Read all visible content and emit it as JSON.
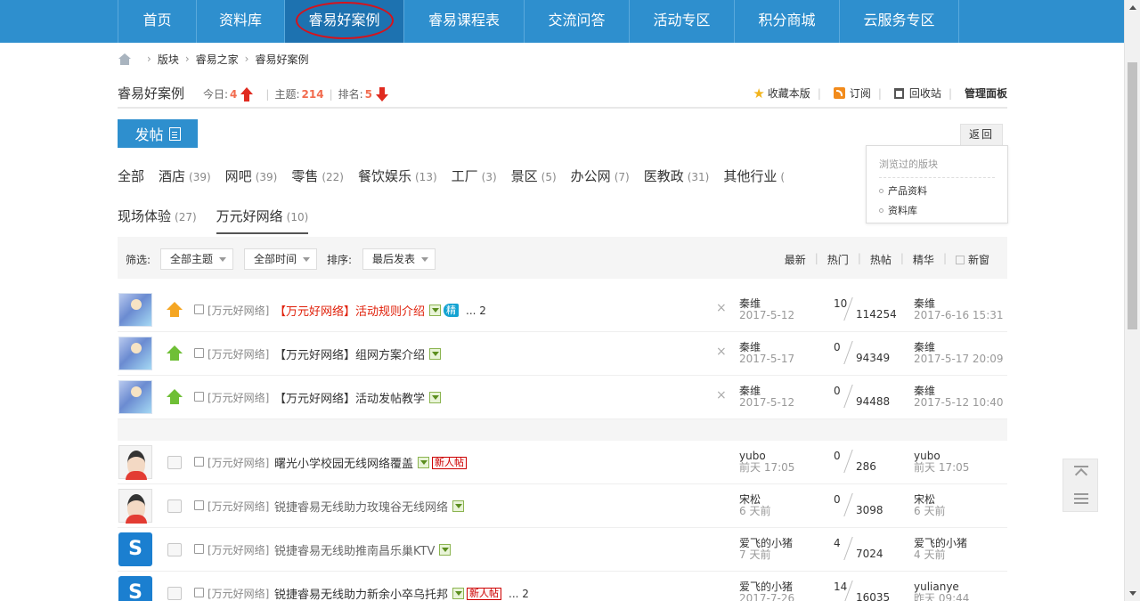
{
  "nav": {
    "items": [
      "首页",
      "资料库",
      "睿易好案例",
      "睿易课程表",
      "交流问答",
      "活动专区",
      "积分商城",
      "云服务专区"
    ],
    "active_index": 2
  },
  "breadcrumb": [
    "版块",
    "睿易之家",
    "睿易好案例"
  ],
  "forum": {
    "name": "睿易好案例",
    "today_label": "今日:",
    "today_value": "4",
    "topics_label": "主题:",
    "topics_value": "214",
    "rank_label": "排名:",
    "rank_value": "5",
    "actions": {
      "favorite": "收藏本版",
      "subscribe": "订阅",
      "recycle": "回收站",
      "admin": "管理面板"
    }
  },
  "post_button": "发帖",
  "back_button": "返回",
  "visited": {
    "title": "浏览过的版块",
    "items": [
      "产品资料",
      "资料库"
    ]
  },
  "categories": [
    {
      "label": "全部",
      "count": ""
    },
    {
      "label": "酒店",
      "count": "(39)"
    },
    {
      "label": "网吧",
      "count": "(39)"
    },
    {
      "label": "零售",
      "count": "(22)"
    },
    {
      "label": "餐饮娱乐",
      "count": "(13)"
    },
    {
      "label": "工厂",
      "count": "(3)"
    },
    {
      "label": "景区",
      "count": "(5)"
    },
    {
      "label": "办公网",
      "count": "(7)"
    },
    {
      "label": "医教政",
      "count": "(31)"
    },
    {
      "label": "其他行业",
      "count": "("
    },
    {
      "label": "现场体验",
      "count": "(27)"
    },
    {
      "label": "万元好网络",
      "count": "(10)"
    }
  ],
  "filter": {
    "filter_label": "筛选:",
    "topic_select": "全部主题",
    "time_select": "全部时间",
    "sort_label": "排序:",
    "sort_select": "最后发表",
    "tabs": [
      "最新",
      "热门",
      "热帖",
      "精华"
    ],
    "new_window": "新窗"
  },
  "threads": [
    {
      "avatar": "elsa",
      "pin": "orange",
      "type": "[万元好网络]",
      "title": "【万元好网络】活动规则介绍",
      "title_style": "red",
      "attach": true,
      "jing": "精",
      "newbie": "",
      "more": "... 2",
      "close": true,
      "author": "秦维",
      "date": "2017-5-12",
      "replies": "10",
      "views": "114254",
      "last_user": "秦维",
      "last_date": "2017-6-16 15:31"
    },
    {
      "avatar": "elsa",
      "pin": "green",
      "type": "[万元好网络]",
      "title": "【万元好网络】组网方案介绍",
      "title_style": "normal",
      "attach": true,
      "jing": "",
      "newbie": "",
      "more": "",
      "close": true,
      "author": "秦维",
      "date": "2017-5-17",
      "replies": "0",
      "views": "94349",
      "last_user": "秦维",
      "last_date": "2017-5-17 20:09"
    },
    {
      "avatar": "elsa",
      "pin": "green",
      "type": "[万元好网络]",
      "title": "【万元好网络】活动发帖教学",
      "title_style": "normal",
      "attach": true,
      "jing": "",
      "newbie": "",
      "more": "",
      "close": true,
      "author": "秦维",
      "date": "2017-5-12",
      "replies": "0",
      "views": "94488",
      "last_user": "秦维",
      "last_date": "2017-5-12 10:40"
    },
    {
      "avatar": "boy",
      "pin": "folder",
      "type": "[万元好网络]",
      "title": "曙光小学校园无线网络覆盖",
      "title_style": "normal",
      "attach": true,
      "jing": "",
      "newbie": "新人帖",
      "more": "",
      "close": false,
      "author": "yubo",
      "date": "前天 17:05",
      "replies": "0",
      "views": "286",
      "last_user": "yubo",
      "last_date": "前天 17:05"
    },
    {
      "avatar": "boy",
      "pin": "folder",
      "type": "[万元好网络]",
      "title": "锐捷睿易无线助力玫瑰谷无线网络",
      "title_style": "gray",
      "attach": true,
      "jing": "",
      "newbie": "",
      "more": "",
      "close": false,
      "author": "宋松",
      "date": "6 天前",
      "replies": "0",
      "views": "3098",
      "last_user": "宋松",
      "last_date": "6 天前"
    },
    {
      "avatar": "logo",
      "pin": "folder",
      "type": "[万元好网络]",
      "title": "锐捷睿易无线助推南昌乐巢KTV",
      "title_style": "gray",
      "attach": true,
      "jing": "",
      "newbie": "",
      "more": "",
      "close": false,
      "author": "爱飞的小猪",
      "date": "7 天前",
      "replies": "4",
      "views": "7024",
      "last_user": "爱飞的小猪",
      "last_date": "4 天前"
    },
    {
      "avatar": "logo",
      "pin": "folder",
      "type": "[万元好网络]",
      "title": "锐捷睿易无线助力新余小卒乌托邦",
      "title_style": "normal",
      "attach": true,
      "jing": "",
      "newbie": "新人帖",
      "more": "... 2",
      "close": false,
      "author": "爱飞的小猪",
      "date": "2017-7-26",
      "replies": "14",
      "views": "16035",
      "last_user": "yulianye",
      "last_date": "昨天 09:44"
    }
  ],
  "colors": {
    "nav_bg": "#2e8fce",
    "nav_active": "#1d72b0",
    "accent_red": "#e0200a",
    "stat_orange": "#f26c4f"
  }
}
